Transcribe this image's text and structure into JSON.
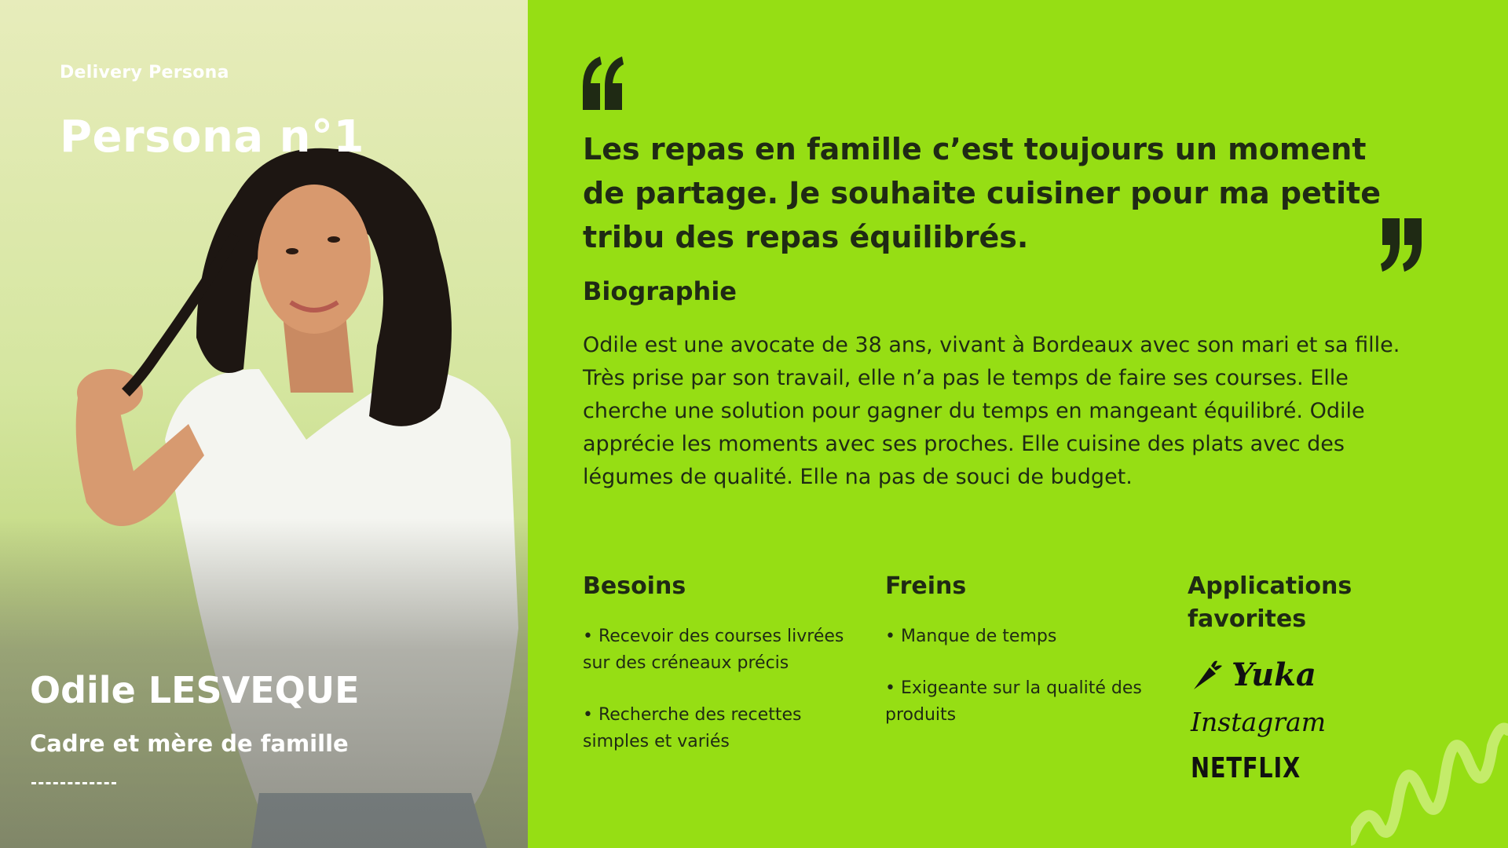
{
  "header": {
    "label": "Delivery Persona",
    "title": "Persona n°1"
  },
  "person": {
    "name": "Odile LESVEQUE",
    "role": "Cadre et mère de famille"
  },
  "quote": {
    "text": "Les repas en famille c’est toujours un moment de partage. Je souhaite cuisiner pour ma petite tribu des repas équilibrés."
  },
  "biography": {
    "title": "Biographie",
    "text": "Odile est une avocate de 38 ans, vivant à Bordeaux avec son mari et sa fille. Très prise par son travail, elle n’a pas le temps de faire ses courses. Elle cherche une solution pour gagner du temps en mangeant équilibré. Odile apprécie les moments avec ses proches. Elle cuisine des plats avec des légumes de qualité. Elle na pas de souci de budget."
  },
  "needs": {
    "title": "Besoins",
    "items": [
      "• Recevoir des courses livrées sur des créneaux précis",
      "• Recherche des recettes simples et variés"
    ]
  },
  "brakes": {
    "title": "Freins",
    "items": [
      "• Manque de temps",
      "• Exigeante sur la qualité des produits"
    ]
  },
  "apps": {
    "title": "Applications favorites",
    "items": [
      {
        "name": "Yuka",
        "icon": "carrot-icon"
      },
      {
        "name": "Instagram",
        "icon": ""
      },
      {
        "name": "NETFLIX",
        "icon": ""
      }
    ]
  },
  "colors": {
    "background": "#96de14",
    "text": "#1f2a14",
    "light": "#ffffff"
  }
}
